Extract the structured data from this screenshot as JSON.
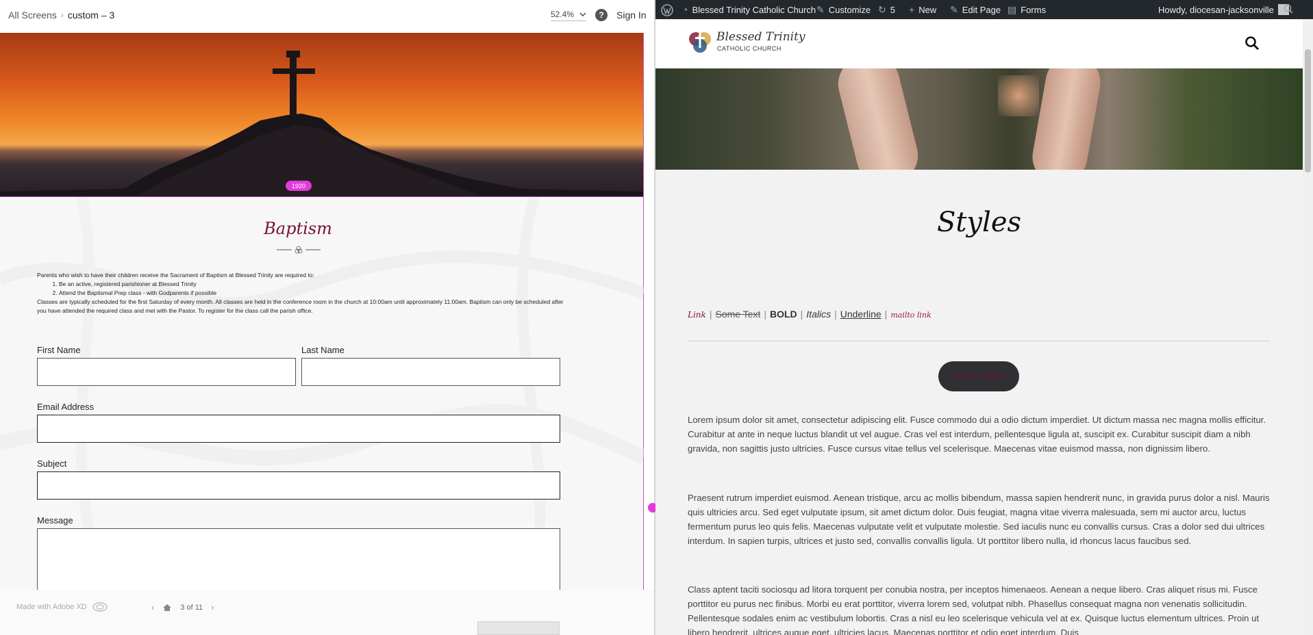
{
  "xd": {
    "breadcrumb_root": "All Screens",
    "breadcrumb_current": "custom – 3",
    "zoom": "52.4%",
    "signin": "Sign In",
    "pill": "1920",
    "title": "Baptism",
    "intro": "Parents who wish to have their children receive the Sacrament of Baptism at Blessed Trinity are required to:",
    "requirements": [
      "Be an active, registered parishioner at Blessed Trinity",
      "Attend the Baptismal Prep class - with Godparents if possible"
    ],
    "closing": "Classes are typically scheduled for the first Saturday of every month. All classes are held in the conference room in the church at 10:00am until approximately 11:00am. Baptism can only be scheduled after you have attended the required class and met with the Pastor. To register for the class call the parish office.",
    "form": {
      "first_name": "First Name",
      "last_name": "Last Name",
      "email": "Email Address",
      "subject": "Subject",
      "message": "Message"
    },
    "footer_made": "Made with Adobe XD",
    "pager": "3 of 11"
  },
  "wp": {
    "admin_bar": {
      "site": "Blessed Trinity Catholic Church",
      "customize": "Customize",
      "updates": "5",
      "new": "New",
      "edit": "Edit Page",
      "forms": "Forms",
      "howdy": "Howdy, diocesan-jacksonville"
    },
    "logo_line1": "Blessed Trinity",
    "logo_line2": "CATHOLIC CHURCH",
    "page_title": "Styles",
    "styles": {
      "link": "Link",
      "strike": "Some Text",
      "bold": "BOLD",
      "italics": "Italics",
      "underline": "Underline",
      "mailto": "mailto link",
      "pipe": "|"
    },
    "button": "Learn More",
    "paragraphs": [
      "Lorem ipsum dolor sit amet, consectetur adipiscing elit. Fusce commodo dui a odio dictum imperdiet. Ut dictum massa nec magna mollis efficitur. Curabitur at ante in neque luctus blandit ut vel augue. Cras vel est interdum, pellentesque ligula at, suscipit ex. Curabitur suscipit diam a nibh gravida, non sagittis justo ultricies. Fusce cursus vitae tellus vel scelerisque. Maecenas vitae euismod massa, non dignissim libero.",
      "Praesent rutrum imperdiet euismod. Aenean tristique, arcu ac mollis bibendum, massa sapien hendrerit nunc, in gravida purus dolor a nisl. Mauris quis ultricies arcu. Sed eget vulputate ipsum, sit amet dictum dolor. Duis feugiat, magna vitae viverra malesuada, sem mi auctor arcu, luctus fermentum purus leo quis felis. Maecenas vulputate velit et vulputate molestie. Sed iaculis nunc eu convallis cursus. Cras a dolor sed dui ultrices interdum. In sapien turpis, ultrices et justo sed, convallis convallis ligula. Ut porttitor libero nulla, id rhoncus lacus faucibus sed.",
      "Class aptent taciti sociosqu ad litora torquent per conubia nostra, per inceptos himenaeos. Aenean a neque libero. Cras aliquet risus mi. Fusce porttitor eu purus nec finibus. Morbi eu erat porttitor, viverra lorem sed, volutpat nibh. Phasellus consequat magna non venenatis sollicitudin. Pellentesque sodales enim ac vestibulum lobortis. Cras a nisl eu leo scelerisque vehicula vel at ex. Quisque luctus elementum ultrices. Proin ut libero hendrerit, ultrices augue eget, ultricies lacus. Maecenas porttitor et odio eget interdum. Duis"
    ]
  },
  "colors": {
    "accent_magenta": "#e43ad9",
    "wine": "#7a1030",
    "admin_bar": "#23282d"
  }
}
